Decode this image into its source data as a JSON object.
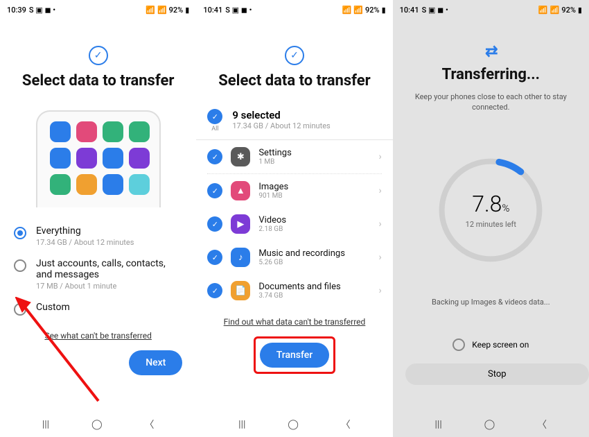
{
  "statusbar": {
    "time1": "10:39",
    "time2": "10:41",
    "time3": "10:41",
    "indicators": "S ▣ ◼ •",
    "battery": "92%"
  },
  "pane1": {
    "title": "Select data to transfer",
    "options": {
      "everything": {
        "label": "Everything",
        "sub": "17.34 GB / About 12 minutes"
      },
      "basic": {
        "label": "Just accounts, calls, contacts, and messages",
        "sub": "17 MB / About 1 minute"
      },
      "custom": {
        "label": "Custom"
      }
    },
    "link": "See what can't be transferred",
    "next": "Next"
  },
  "pane2": {
    "title": "Select data to transfer",
    "all": {
      "label": "All",
      "title": "9 selected",
      "sub": "17.34 GB / About 12 minutes"
    },
    "cats": [
      {
        "name": "Settings",
        "sub": "1 MB",
        "color": "#5a5a5a",
        "glyph": "✱"
      },
      {
        "name": "Images",
        "sub": "901 MB",
        "color": "#e24a7a",
        "glyph": "▲"
      },
      {
        "name": "Videos",
        "sub": "2.18 GB",
        "color": "#7d3bd6",
        "glyph": "▶"
      },
      {
        "name": "Music and recordings",
        "sub": "5.26 GB",
        "color": "#2b7de9",
        "glyph": "♪"
      },
      {
        "name": "Documents and files",
        "sub": "3.74 GB",
        "color": "#f0a030",
        "glyph": "📄"
      }
    ],
    "link": "Find out what data can't be transferred",
    "transfer": "Transfer"
  },
  "pane3": {
    "title": "Transferring...",
    "subtitle": "Keep your phones close to each other to stay connected.",
    "progress": {
      "pct": "7.8",
      "unit": "%",
      "time": "12 minutes left",
      "value": 7.8
    },
    "backing": "Backing up Images & videos data...",
    "keep": "Keep screen on",
    "stop": "Stop"
  },
  "appcolors": [
    "#2b7de9",
    "#e24a7a",
    "#32b27a",
    "#32b27a",
    "#2b7de9",
    "#7d3bd6",
    "#2b7de9",
    "#7d3bd6",
    "#32b27a",
    "#f0a030",
    "#2b7de9",
    "#5dcfdc"
  ]
}
